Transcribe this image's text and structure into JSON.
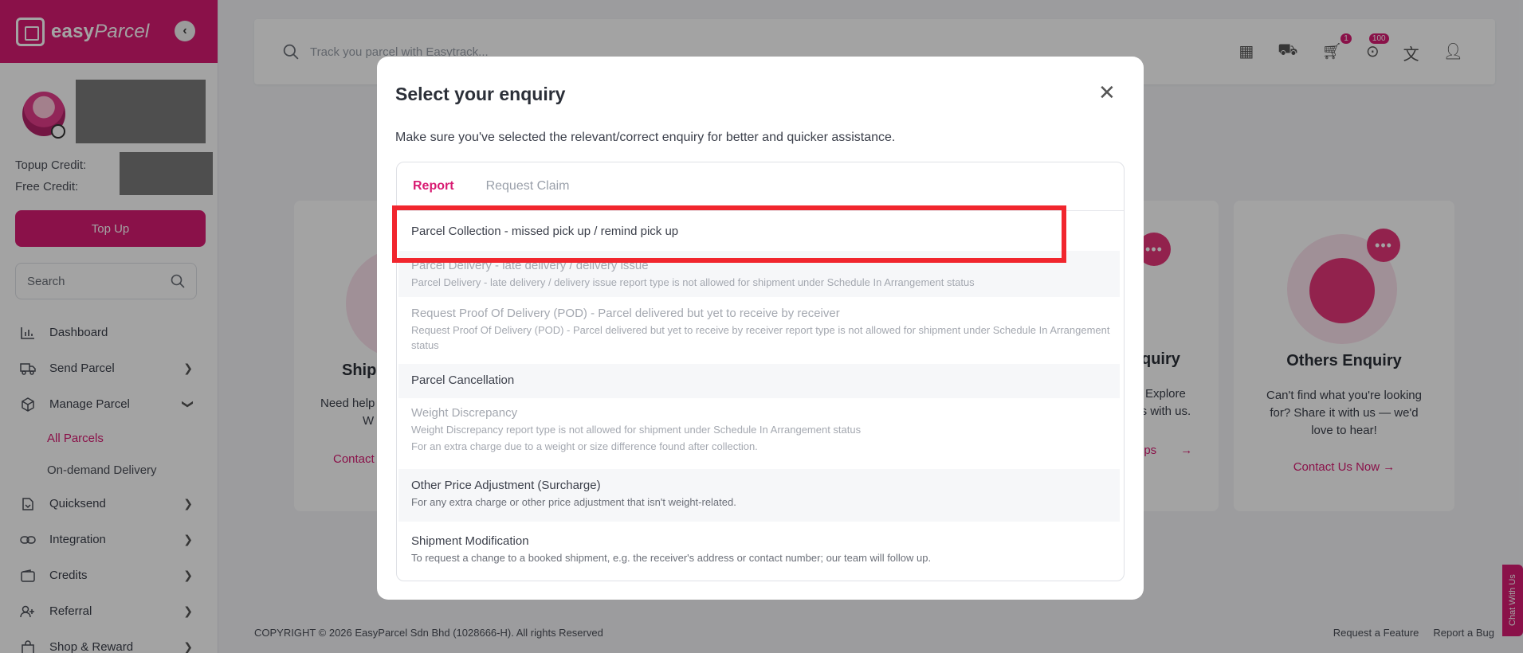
{
  "brand": {
    "name_bold": "easy",
    "name_thin": "Parcel"
  },
  "profile": {
    "topup_label": "Topup Credit:",
    "free_label": "Free Credit:",
    "topup_button": "Top Up"
  },
  "sidebar": {
    "search_placeholder": "Search",
    "items": [
      {
        "label": "Dashboard"
      },
      {
        "label": "Send Parcel"
      },
      {
        "label": "Manage Parcel"
      },
      {
        "label": "Quicksend"
      },
      {
        "label": "Integration"
      },
      {
        "label": "Credits"
      },
      {
        "label": "Referral"
      },
      {
        "label": "Shop & Reward"
      }
    ],
    "subitems": [
      {
        "label": "All Parcels"
      },
      {
        "label": "On-demand Delivery"
      }
    ]
  },
  "topbar": {
    "search_placeholder": "Track you parcel with Easytrack...",
    "cart_badge": "1",
    "notif_badge": "100"
  },
  "cards": {
    "shipment": {
      "title_partial": "Shipm",
      "desc_partial": "Need help",
      "desc_partial2": "W",
      "link_partial": "Contact"
    },
    "third": {
      "title_partial": "quiry",
      "desc_partial": "Explore",
      "desc_partial2": "ies with us.",
      "link_partial": "ips"
    },
    "others": {
      "title": "Others Enquiry",
      "desc": "Can't find what you're looking for? Share it with us — we'd love to hear!",
      "link": "Contact Us Now"
    }
  },
  "footer": {
    "copyright": "COPYRIGHT © 2026 EasyParcel Sdn Bhd (1028666-H). All rights Reserved",
    "request_feature": "Request a Feature",
    "report_bug": "Report a Bug"
  },
  "chat_tab": "Chat With Us",
  "modal": {
    "title": "Select your enquiry",
    "description": "Make sure you've selected the relevant/correct enquiry for better and quicker assistance.",
    "tabs": [
      {
        "label": "Report"
      },
      {
        "label": "Request Claim"
      }
    ],
    "options": [
      {
        "title": "Parcel Collection - missed pick up / remind pick up",
        "desc": ""
      },
      {
        "title": "Parcel Delivery - late delivery / delivery issue",
        "desc": "Parcel Delivery - late delivery / delivery issue report type is not allowed for shipment under Schedule In Arrangement status"
      },
      {
        "title": "Request Proof Of Delivery (POD) - Parcel delivered but yet to receive by receiver",
        "desc": "Request Proof Of Delivery (POD) - Parcel delivered but yet to receive by receiver report type is not allowed for shipment under Schedule In Arrangement status"
      },
      {
        "title": "Parcel Cancellation",
        "desc": ""
      },
      {
        "title": "Weight Discrepancy",
        "desc": "Weight Discrepancy report type is not allowed for shipment under Schedule In Arrangement status",
        "desc2": "For an extra charge due to a weight or size difference found after collection."
      },
      {
        "title": "Other Price Adjustment (Surcharge)",
        "desc": "For any extra charge or other price adjustment that isn't weight-related."
      },
      {
        "title": "Shipment Modification",
        "desc": "To request a change to a booked shipment, e.g. the receiver's address or contact number; our team will follow up."
      }
    ]
  }
}
